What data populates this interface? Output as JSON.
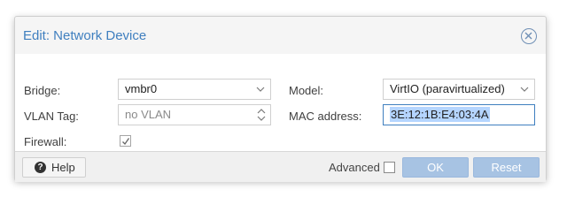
{
  "dialog": {
    "title": "Edit: Network Device",
    "close_icon": "close-circle-icon"
  },
  "form": {
    "bridge": {
      "label": "Bridge:",
      "value": "vmbr0"
    },
    "vlan": {
      "label": "VLAN Tag:",
      "placeholder": "no VLAN"
    },
    "firewall": {
      "label": "Firewall:",
      "checked": true
    },
    "model": {
      "label": "Model:",
      "value": "VirtIO (paravirtualized)"
    },
    "mac": {
      "label": "MAC address:",
      "value": "3E:12:1B:E4:03:4A"
    }
  },
  "footer": {
    "help_label": "Help",
    "advanced_label": "Advanced",
    "ok_label": "OK",
    "reset_label": "Reset"
  },
  "colors": {
    "title": "#3f7fbf",
    "primary_disabled": "#a7c3e3",
    "focus_border": "#3f7fbf",
    "selection": "#b5d5ff"
  }
}
